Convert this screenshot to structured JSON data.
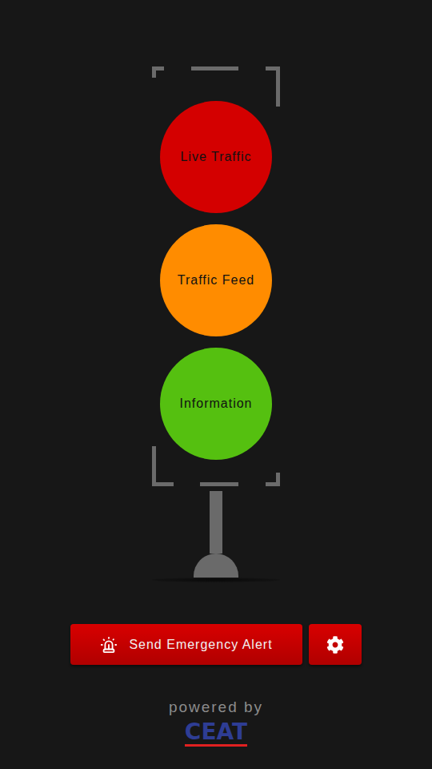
{
  "lights": [
    {
      "label": "Live Traffic",
      "color": "#d40000"
    },
    {
      "label": "Traffic Feed",
      "color": "#ff8c00"
    },
    {
      "label": "Information",
      "color": "#55c010"
    }
  ],
  "alert_button": {
    "label": "Send Emergency Alert"
  },
  "footer": {
    "powered_by": "powered by",
    "brand": "CEAT"
  }
}
